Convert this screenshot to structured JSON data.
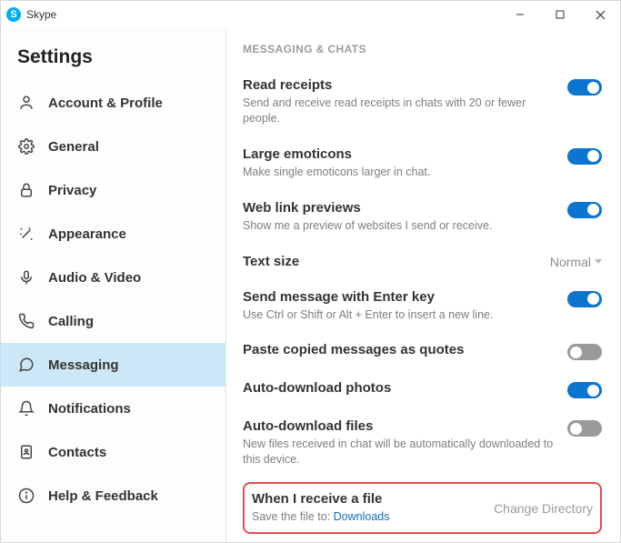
{
  "window": {
    "title": "Skype",
    "logo_letter": "S"
  },
  "sidebar": {
    "heading": "Settings",
    "items": [
      {
        "id": "account",
        "label": "Account & Profile",
        "icon": "person-icon"
      },
      {
        "id": "general",
        "label": "General",
        "icon": "gear-icon"
      },
      {
        "id": "privacy",
        "label": "Privacy",
        "icon": "lock-icon"
      },
      {
        "id": "appearance",
        "label": "Appearance",
        "icon": "wand-icon"
      },
      {
        "id": "audio-video",
        "label": "Audio & Video",
        "icon": "mic-icon"
      },
      {
        "id": "calling",
        "label": "Calling",
        "icon": "phone-icon"
      },
      {
        "id": "messaging",
        "label": "Messaging",
        "icon": "chat-icon"
      },
      {
        "id": "notifications",
        "label": "Notifications",
        "icon": "bell-icon"
      },
      {
        "id": "contacts",
        "label": "Contacts",
        "icon": "book-icon"
      },
      {
        "id": "help",
        "label": "Help & Feedback",
        "icon": "info-icon"
      }
    ]
  },
  "main": {
    "section_header": "MESSAGING & CHATS",
    "read_receipts": {
      "title": "Read receipts",
      "desc": "Send and receive read receipts in chats with 20 or fewer people."
    },
    "large_emoticons": {
      "title": "Large emoticons",
      "desc": "Make single emoticons larger in chat."
    },
    "web_previews": {
      "title": "Web link previews",
      "desc": "Show me a preview of websites I send or receive."
    },
    "text_size": {
      "title": "Text size",
      "value": "Normal"
    },
    "enter_send": {
      "title": "Send message with Enter key",
      "desc": "Use Ctrl or Shift or Alt + Enter to insert a new line."
    },
    "paste_quotes": {
      "title": "Paste copied messages as quotes"
    },
    "autodl_photos": {
      "title": "Auto-download photos"
    },
    "autodl_files": {
      "title": "Auto-download files",
      "desc": "New files received in chat will be automatically downloaded to this device."
    },
    "receive_file": {
      "title": "When I receive a file",
      "desc_prefix": "Save the file to: ",
      "link": "Downloads",
      "button": "Change Directory"
    }
  }
}
